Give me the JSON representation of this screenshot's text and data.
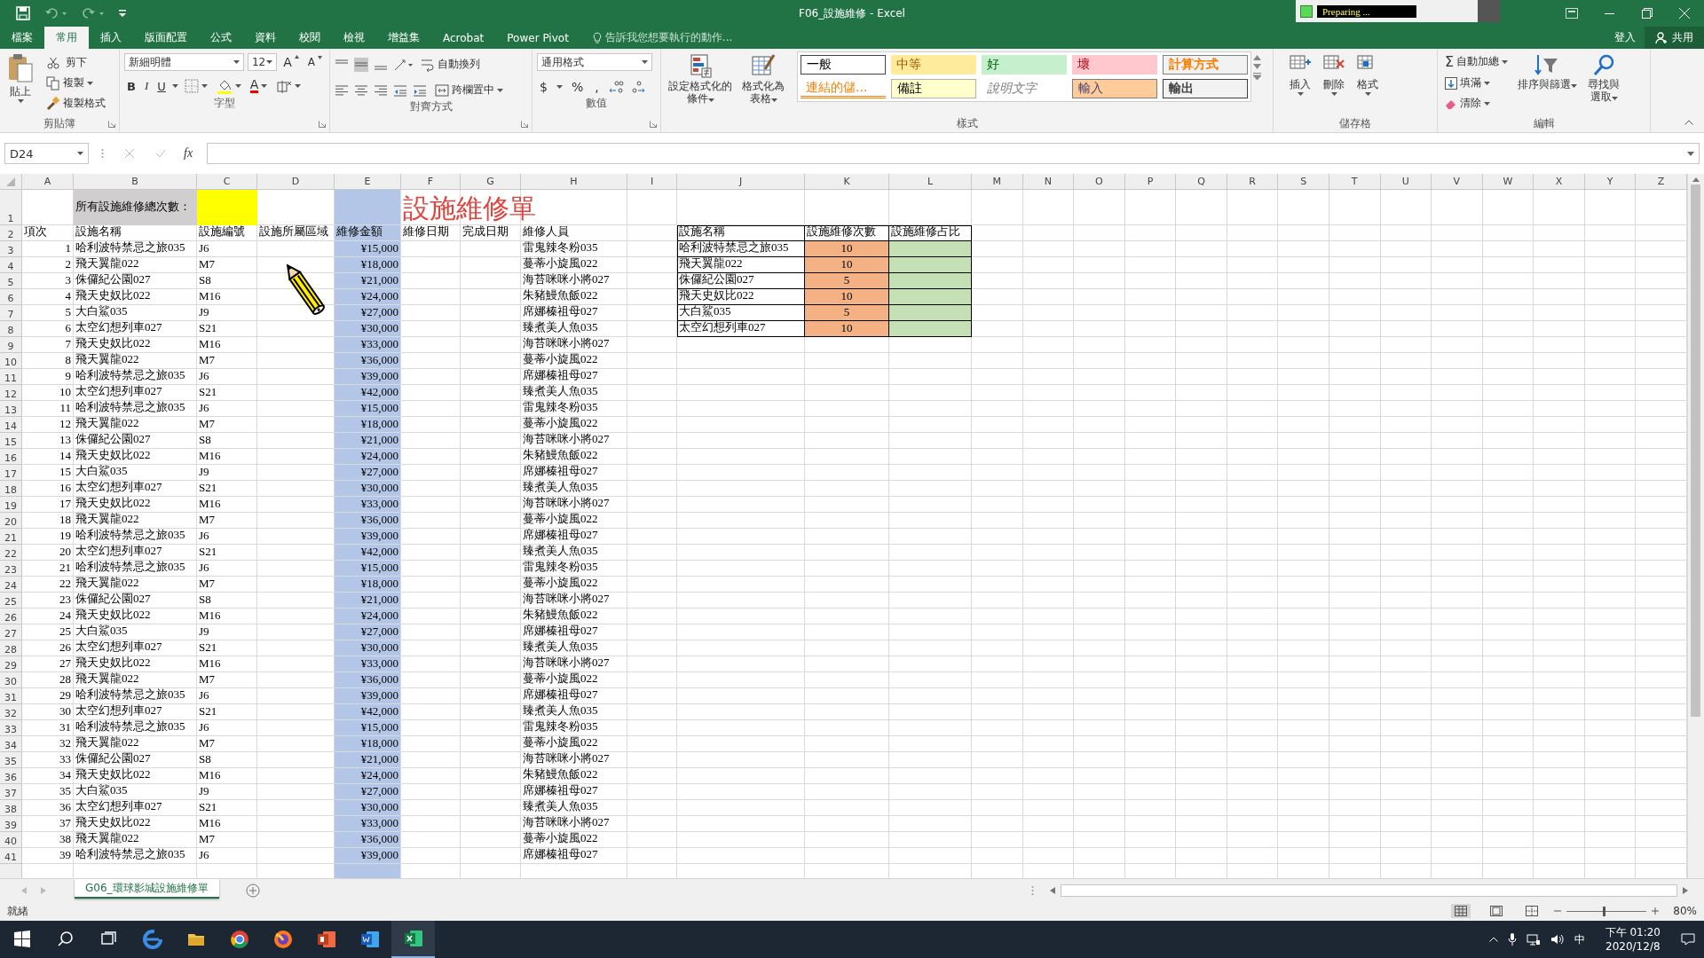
{
  "window": {
    "title": "F06_設施維修 - Excel",
    "progress_popup": "Preparing ..."
  },
  "ribbon_tabs": [
    {
      "label": "檔案",
      "selected": false
    },
    {
      "label": "常用",
      "selected": true
    },
    {
      "label": "插入",
      "selected": false
    },
    {
      "label": "版面配置",
      "selected": false
    },
    {
      "label": "公式",
      "selected": false
    },
    {
      "label": "資料",
      "selected": false
    },
    {
      "label": "校閱",
      "selected": false
    },
    {
      "label": "檢視",
      "selected": false
    },
    {
      "label": "增益集",
      "selected": false
    },
    {
      "label": "Acrobat",
      "selected": false
    },
    {
      "label": "Power Pivot",
      "selected": false
    }
  ],
  "tell_me": {
    "placeholder": "告訴我您想要執行的動作..."
  },
  "account": {
    "sign_in": "登入",
    "share": "共用"
  },
  "clipboard": {
    "label": "剪貼簿",
    "paste": "貼上",
    "cut": "剪下",
    "copy": "複製",
    "format_painter": "複製格式"
  },
  "font": {
    "label": "字型",
    "font_name": "新細明體",
    "font_size": "12",
    "grow": "A",
    "shrink": "A",
    "format_buttons": [
      {
        "label": "B",
        "kind": "bold"
      },
      {
        "label": "I",
        "kind": "italic"
      },
      {
        "label": "U",
        "kind": "underline"
      }
    ],
    "font_color": "A"
  },
  "alignment": {
    "label": "對齊方式",
    "wrap_text": "自動換列",
    "merge_center": "跨欄置中"
  },
  "number": {
    "label": "數值",
    "format": "通用格式",
    "symbols": [
      "$",
      "%",
      ","
    ]
  },
  "styles": {
    "label": "樣式",
    "conditional_formatting": "設定格式化的條件",
    "format_as_table": "格式化為表格",
    "cell_styles": [
      {
        "label": "一般",
        "kind": "normal"
      },
      {
        "label": "中等",
        "kind": "neutral"
      },
      {
        "label": "好",
        "kind": "good"
      },
      {
        "label": "壞",
        "kind": "bad"
      },
      {
        "label": "計算方式",
        "kind": "calculation"
      },
      {
        "label": "連結的儲...",
        "kind": "linked"
      },
      {
        "label": "備註",
        "kind": "note"
      },
      {
        "label": "說明文字",
        "kind": "explanatory"
      },
      {
        "label": "輸入",
        "kind": "input"
      },
      {
        "label": "輸出",
        "kind": "output"
      }
    ]
  },
  "cells": {
    "label": "儲存格",
    "insert": "插入",
    "delete": "刪除",
    "format": "格式"
  },
  "editing": {
    "label": "編輯",
    "autosum_symbol": "Σ",
    "autosum": "自動加總",
    "fill": "填滿",
    "clear": "清除",
    "sort_filter": "排序與篩選",
    "find_select": "尋找與選取"
  },
  "formula_bar": {
    "name_box": "D24",
    "function_label": "fx"
  },
  "sheet": {
    "columns": [
      "A",
      "B",
      "C",
      "D",
      "E",
      "F",
      "G",
      "H",
      "I",
      "J",
      "K",
      "L",
      "M",
      "N",
      "O",
      "P",
      "Q",
      "R",
      "S",
      "T",
      "U",
      "V",
      "W",
      "X",
      "Y",
      "Z"
    ],
    "row_numbers": [
      "1",
      "2",
      "3",
      "4",
      "5",
      "6",
      "7",
      "8",
      "9",
      "10",
      "11",
      "12",
      "13",
      "14",
      "15",
      "16",
      "17",
      "18",
      "19",
      "20",
      "21",
      "22",
      "23",
      "24",
      "25",
      "26",
      "27",
      "28",
      "29",
      "30",
      "31",
      "32",
      "33",
      "34",
      "35",
      "36",
      "37",
      "38",
      "39",
      "40",
      "41"
    ],
    "total_label": "所有設施維修總次數：",
    "title": "設施維修單",
    "headers": [
      "項次",
      "設施名稱",
      "設施編號",
      "設施所屬區域",
      "維修金額",
      "維修日期",
      "完成日期",
      "維修人員"
    ],
    "rows": [
      {
        "no": "1",
        "name": "哈利波特禁忌之旅035",
        "code": "J6",
        "amount": "¥15,000",
        "staff": "雷鬼辣冬粉035"
      },
      {
        "no": "2",
        "name": "飛天翼龍022",
        "code": "M7",
        "amount": "¥18,000",
        "staff": "蔓蒂小旋風022"
      },
      {
        "no": "3",
        "name": "侏儸紀公園027",
        "code": "S8",
        "amount": "¥21,000",
        "staff": "海苔咪咪小將027"
      },
      {
        "no": "4",
        "name": "飛天史奴比022",
        "code": "M16",
        "amount": "¥24,000",
        "staff": "朱豬鰻魚飯022"
      },
      {
        "no": "5",
        "name": "大白鯊035",
        "code": "J9",
        "amount": "¥27,000",
        "staff": "席娜榛祖母027"
      },
      {
        "no": "6",
        "name": "太空幻想列車027",
        "code": "S21",
        "amount": "¥30,000",
        "staff": "臻煮美人魚035"
      },
      {
        "no": "7",
        "name": "飛天史奴比022",
        "code": "M16",
        "amount": "¥33,000",
        "staff": "海苔咪咪小將027"
      },
      {
        "no": "8",
        "name": "飛天翼龍022",
        "code": "M7",
        "amount": "¥36,000",
        "staff": "蔓蒂小旋風022"
      },
      {
        "no": "9",
        "name": "哈利波特禁忌之旅035",
        "code": "J6",
        "amount": "¥39,000",
        "staff": "席娜榛祖母027"
      },
      {
        "no": "10",
        "name": "太空幻想列車027",
        "code": "S21",
        "amount": "¥42,000",
        "staff": "臻煮美人魚035"
      },
      {
        "no": "11",
        "name": "哈利波特禁忌之旅035",
        "code": "J6",
        "amount": "¥15,000",
        "staff": "雷鬼辣冬粉035"
      },
      {
        "no": "12",
        "name": "飛天翼龍022",
        "code": "M7",
        "amount": "¥18,000",
        "staff": "蔓蒂小旋風022"
      },
      {
        "no": "13",
        "name": "侏儸紀公園027",
        "code": "S8",
        "amount": "¥21,000",
        "staff": "海苔咪咪小將027"
      },
      {
        "no": "14",
        "name": "飛天史奴比022",
        "code": "M16",
        "amount": "¥24,000",
        "staff": "朱豬鰻魚飯022"
      },
      {
        "no": "15",
        "name": "大白鯊035",
        "code": "J9",
        "amount": "¥27,000",
        "staff": "席娜榛祖母027"
      },
      {
        "no": "16",
        "name": "太空幻想列車027",
        "code": "S21",
        "amount": "¥30,000",
        "staff": "臻煮美人魚035"
      },
      {
        "no": "17",
        "name": "飛天史奴比022",
        "code": "M16",
        "amount": "¥33,000",
        "staff": "海苔咪咪小將027"
      },
      {
        "no": "18",
        "name": "飛天翼龍022",
        "code": "M7",
        "amount": "¥36,000",
        "staff": "蔓蒂小旋風022"
      },
      {
        "no": "19",
        "name": "哈利波特禁忌之旅035",
        "code": "J6",
        "amount": "¥39,000",
        "staff": "席娜榛祖母027"
      },
      {
        "no": "20",
        "name": "太空幻想列車027",
        "code": "S21",
        "amount": "¥42,000",
        "staff": "臻煮美人魚035"
      },
      {
        "no": "21",
        "name": "哈利波特禁忌之旅035",
        "code": "J6",
        "amount": "¥15,000",
        "staff": "雷鬼辣冬粉035"
      },
      {
        "no": "22",
        "name": "飛天翼龍022",
        "code": "M7",
        "amount": "¥18,000",
        "staff": "蔓蒂小旋風022"
      },
      {
        "no": "23",
        "name": "侏儸紀公園027",
        "code": "S8",
        "amount": "¥21,000",
        "staff": "海苔咪咪小將027"
      },
      {
        "no": "24",
        "name": "飛天史奴比022",
        "code": "M16",
        "amount": "¥24,000",
        "staff": "朱豬鰻魚飯022"
      },
      {
        "no": "25",
        "name": "大白鯊035",
        "code": "J9",
        "amount": "¥27,000",
        "staff": "席娜榛祖母027"
      },
      {
        "no": "26",
        "name": "太空幻想列車027",
        "code": "S21",
        "amount": "¥30,000",
        "staff": "臻煮美人魚035"
      },
      {
        "no": "27",
        "name": "飛天史奴比022",
        "code": "M16",
        "amount": "¥33,000",
        "staff": "海苔咪咪小將027"
      },
      {
        "no": "28",
        "name": "飛天翼龍022",
        "code": "M7",
        "amount": "¥36,000",
        "staff": "蔓蒂小旋風022"
      },
      {
        "no": "29",
        "name": "哈利波特禁忌之旅035",
        "code": "J6",
        "amount": "¥39,000",
        "staff": "席娜榛祖母027"
      },
      {
        "no": "30",
        "name": "太空幻想列車027",
        "code": "S21",
        "amount": "¥42,000",
        "staff": "臻煮美人魚035"
      },
      {
        "no": "31",
        "name": "哈利波特禁忌之旅035",
        "code": "J6",
        "amount": "¥15,000",
        "staff": "雷鬼辣冬粉035"
      },
      {
        "no": "32",
        "name": "飛天翼龍022",
        "code": "M7",
        "amount": "¥18,000",
        "staff": "蔓蒂小旋風022"
      },
      {
        "no": "33",
        "name": "侏儸紀公園027",
        "code": "S8",
        "amount": "¥21,000",
        "staff": "海苔咪咪小將027"
      },
      {
        "no": "34",
        "name": "飛天史奴比022",
        "code": "M16",
        "amount": "¥24,000",
        "staff": "朱豬鰻魚飯022"
      },
      {
        "no": "35",
        "name": "大白鯊035",
        "code": "J9",
        "amount": "¥27,000",
        "staff": "席娜榛祖母027"
      },
      {
        "no": "36",
        "name": "太空幻想列車027",
        "code": "S21",
        "amount": "¥30,000",
        "staff": "臻煮美人魚035"
      },
      {
        "no": "37",
        "name": "飛天史奴比022",
        "code": "M16",
        "amount": "¥33,000",
        "staff": "海苔咪咪小將027"
      },
      {
        "no": "38",
        "name": "飛天翼龍022",
        "code": "M7",
        "amount": "¥36,000",
        "staff": "蔓蒂小旋風022"
      },
      {
        "no": "39",
        "name": "哈利波特禁忌之旅035",
        "code": "J6",
        "amount": "¥39,000",
        "staff": "席娜榛祖母027"
      }
    ],
    "summary": {
      "headers": [
        "設施名稱",
        "設施維修次數",
        "設施維修占比"
      ],
      "rows": [
        {
          "name": "哈利波特禁忌之旅035",
          "count": "10"
        },
        {
          "name": "飛天翼龍022",
          "count": "10"
        },
        {
          "name": "侏儸紀公園027",
          "count": "5"
        },
        {
          "name": "飛天史奴比022",
          "count": "10"
        },
        {
          "name": "大白鯊035",
          "count": "5"
        },
        {
          "name": "太空幻想列車027",
          "count": "10"
        }
      ]
    }
  },
  "sheet_tabs": [
    {
      "label": "G06_環球影城設施維修單",
      "selected": true
    }
  ],
  "status_bar": {
    "status": "就緒",
    "views": [
      {
        "selected": true
      },
      {
        "selected": false
      },
      {
        "selected": false
      }
    ],
    "zoom": {
      "reading": "80%",
      "level": 0.45
    }
  },
  "taskbar": {
    "ime": "中",
    "time": "下午 01:20",
    "date": "2020/12/8"
  }
}
